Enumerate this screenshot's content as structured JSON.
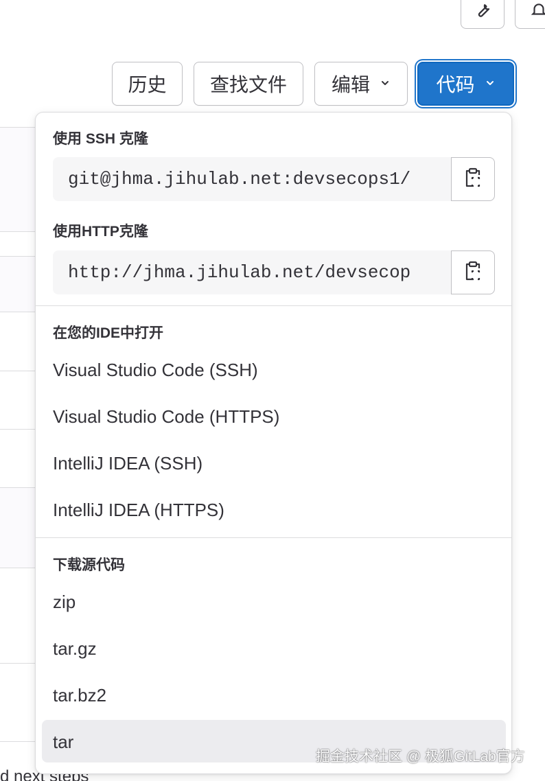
{
  "colors": {
    "primary": "#1f75cb",
    "text": "#333238",
    "border": "#bfbfc3",
    "hover_bg": "#ececef",
    "field_bg": "#f6f6f7"
  },
  "top_icons": [
    "wrench-icon",
    "bell-icon"
  ],
  "toolbar": {
    "history_label": "历史",
    "find_file_label": "查找文件",
    "edit_label": "编辑",
    "code_label": "代码"
  },
  "dropdown": {
    "ssh": {
      "title": "使用 SSH 克隆",
      "url": "git@jhma.jihulab.net:devsecops1/"
    },
    "http": {
      "title": "使用HTTP克隆",
      "url": "http://jhma.jihulab.net/devsecop"
    },
    "ide": {
      "title": "在您的IDE中打开",
      "items": [
        "Visual Studio Code (SSH)",
        "Visual Studio Code (HTTPS)",
        "IntelliJ IDEA (SSH)",
        "IntelliJ IDEA (HTTPS)"
      ]
    },
    "download": {
      "title": "下载源代码",
      "items": [
        "zip",
        "tar.gz",
        "tar.bz2",
        "tar"
      ]
    }
  },
  "background": {
    "partial_text": "d next steps"
  },
  "watermark": "掘金技术社区 @ 极狐GitLab官方"
}
